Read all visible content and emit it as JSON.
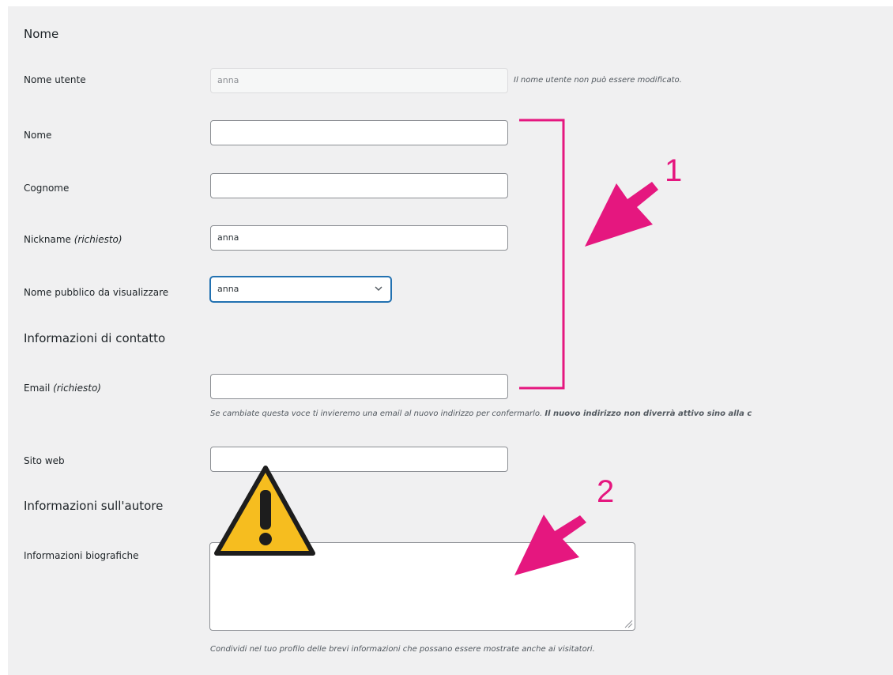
{
  "sections": {
    "name": "Nome",
    "contact": "Informazioni di contatto",
    "author": "Informazioni sull'autore"
  },
  "fields": {
    "username": {
      "label": "Nome utente",
      "value": "anna",
      "note": "Il nome utente non può essere modificato."
    },
    "first_name": {
      "label": "Nome",
      "value": ""
    },
    "last_name": {
      "label": "Cognome",
      "value": ""
    },
    "nickname": {
      "label": "Nickname",
      "required": "(richiesto)",
      "value": "anna"
    },
    "display_name": {
      "label": "Nome pubblico da visualizzare",
      "value": "anna",
      "options": [
        "anna"
      ]
    },
    "email": {
      "label": "Email",
      "required": "(richiesto)",
      "value": "",
      "note": "Se cambiate questa voce ti invieremo una email al nuovo indirizzo per confermarlo.",
      "note_bold": "Il nuovo indirizzo non diverrà attivo sino alla c"
    },
    "website": {
      "label": "Sito web",
      "value": ""
    },
    "bio": {
      "label": "Informazioni biografiche",
      "value": "",
      "note": "Condividi nel tuo profilo delle brevi informazioni che possano essere mostrate anche ai visitatori."
    }
  },
  "annotations": {
    "callout_1": "1",
    "callout_2": "2",
    "accent_color": "#e5177f",
    "warning_color": "#f6bd1f",
    "warning_icon": "warning-triangle-icon"
  }
}
